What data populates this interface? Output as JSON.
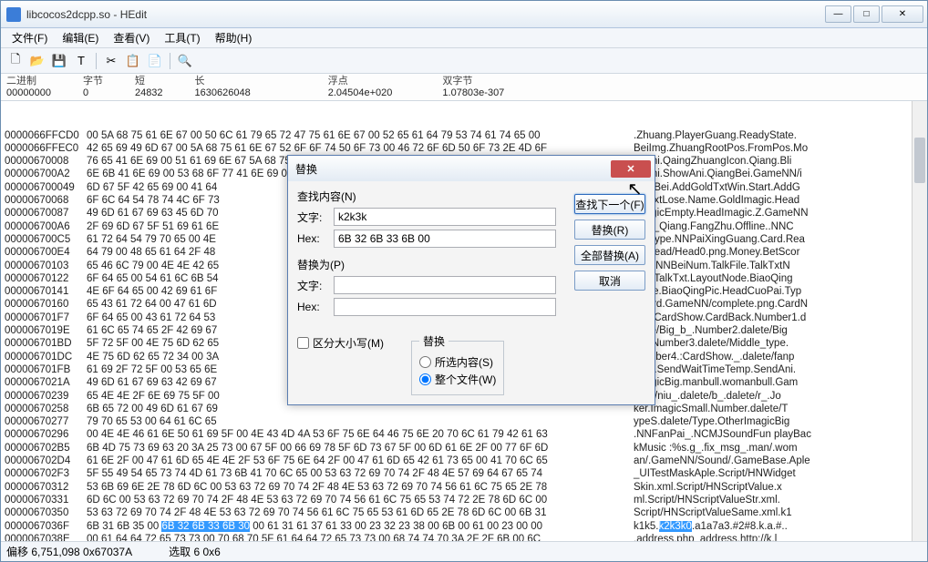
{
  "window": {
    "title": "libcocos2dcpp.so - HEdit"
  },
  "menu": {
    "file": "文件(F)",
    "edit": "编辑(E)",
    "view": "查看(V)",
    "tools": "工具(T)",
    "help": "帮助(H)"
  },
  "info": {
    "binary_lbl": "二进制",
    "binary_val": "00000000",
    "byte_lbl": "字节",
    "byte_val": "0",
    "short_lbl": "短",
    "short_val": "24832",
    "long_lbl": "长",
    "long_val": "1630626048",
    "float_lbl": "浮点",
    "float_val": "2.04504e+020",
    "dword_lbl": "双字节",
    "dword_val": "1.07803e-307"
  },
  "status": {
    "offset": "偏移 6,751,098 0x67037A",
    "selection": "选取 6 0x6"
  },
  "dialog": {
    "title": "替换",
    "find_label": "查找内容(N)",
    "replace_label": "替换为(P)",
    "text_lbl": "文字:",
    "hex_lbl": "Hex:",
    "find_text": "k2k3k",
    "find_hex": "6B 32 6B 33 6B 00",
    "replace_text": "",
    "replace_hex": "",
    "btn_findnext": "查找下一个(F)",
    "btn_replace": "替换(R)",
    "btn_replaceall": "全部替换(A)",
    "btn_cancel": "取消",
    "chk_case": "区分大小写(M)",
    "scope_legend": "替换",
    "scope_sel": "所选内容(S)",
    "scope_all": "整个文件(W)"
  },
  "hex_rows": [
    {
      "a": "0000066FFCD0",
      "h": "00 5A 68 75 61 6E 67 00 50 6C 61 79 65 72 47 75 61 6E 67 00 52 65 61 64 79 53 74 61 74 65 00",
      "t": ".Zhuang.PlayerGuang.ReadyState."
    },
    {
      "a": "0000066FFEC0",
      "h": "42 65 69 49 6D 67 00 5A 68 75 61 6E 67 52 6F 6F 74 50 6F 73 00 46 72 6F 6D 50 6F 73 2E 4D 6F",
      "t": "BeiImg.ZhuangRootPos.FromPos.Mo"
    },
    {
      "a": "00000670008 ",
      "h": "76 65 41 6E 69 00 51 61 69 6E 67 5A 68 75 61 6E 67 49 63 6F 6E 00 51 69 61 6E 67 00 42 6C 69",
      "t": "veAni.QaingZhuangIcon.Qiang.Bli"
    },
    {
      "a": "000006700A2 ",
      "h": "6E 6B 41 6E 69 00 53 68 6F 77 41 6E 69 00 51 69 61 6E 67 42 65 69 00 47 61 6D 65 4E 4E 2F 69",
      "t": "nkAni.ShowAni.QiangBei.GameNN/i"
    },
    {
      "a": "000006700049",
      "h": "6D 67 5F 42 65 69 00 41 64",
      "t": "mg_Bei.AddGoldTxtWin.Start.AddG",
      "short": true
    },
    {
      "a": "00000670068 ",
      "h": "6F 6C 64 54 78 74 4C 6F 73",
      "t": "oldTxtLose.Name.GoldImagic.Head",
      "short": true
    },
    {
      "a": "00000670087 ",
      "h": "49 6D 61 67 69 63 45 6D 70",
      "t": "ImagicEmpty.HeadImagic.Z.GameNN",
      "short": true
    },
    {
      "a": "000006700A6 ",
      "h": "2F 69 6D 67 5F 51 69 61 6E",
      "t": "/img_Qiang.FangZhu.Offline..NNC",
      "short": true
    },
    {
      "a": "000006700C5 ",
      "h": "61 72 64 54 79 70 65 00 4E",
      "t": "ardType.NNPaiXingGuang.Card.Rea",
      "short": true
    },
    {
      "a": "000006700E4 ",
      "h": "64 79 00 48 65 61 64 2F 48",
      "t": "dy.Head/Head0.png.Money.BetScor",
      "short": true
    },
    {
      "a": "00000670103 ",
      "h": "65 46 6C 79 00 4E 4E 42 65",
      "t": "eFly.NNBeiNum.TalkFile.TalkTxtN",
      "short": true
    },
    {
      "a": "00000670122 ",
      "h": "6F 64 65 00 54 61 6C 6B 54",
      "t": "ode.TalkTxt.LayoutNode.BiaoQing",
      "short": true
    },
    {
      "a": "00000670141 ",
      "h": "4E 6F 64 65 00 42 69 61 6F",
      "t": "Node.BiaoQingPic.HeadCuoPai.Typ",
      "short": true
    },
    {
      "a": "00000670160 ",
      "h": "65 43 61 72 64 00 47 61 6D",
      "t": "eCard.GameNN/complete.png.CardN",
      "short": true
    },
    {
      "a": "000006701F7 ",
      "h": "6F 64 65 00 43 61 72 64 53",
      "t": "ode.CardShow.CardBack.Number1.d",
      "short": true
    },
    {
      "a": "0000067019E ",
      "h": "61 6C 65 74 65 2F 42 69 67",
      "t": "alete/Big_b_.Number2.dalete/Big",
      "short": true
    },
    {
      "a": "000006701BD ",
      "h": "5F 72 5F 00 4E 75 6D 62 65",
      "t": "_r_.Number3.dalete/Middle_type.",
      "short": true
    },
    {
      "a": "000006701DC ",
      "h": "4E 75 6D 62 65 72 34 00 3A",
      "t": "Number4.:CardShow._.dalete/fanp",
      "short": true
    },
    {
      "a": "000006701FB ",
      "h": "61 69 2F 72 5F 00 53 65 6E",
      "t": "ai/r_.SendWaitTimeTemp.SendAni.",
      "short": true
    },
    {
      "a": "0000067021A ",
      "h": "49 6D 61 67 69 63 42 69 67",
      "t": "ImagicBig.manbull.womanbull.Gam",
      "short": true
    },
    {
      "a": "00000670239 ",
      "h": "65 4E 4E 2F 6E 69 75 5F 00",
      "t": "eNN/niu_.dalete/b_.dalete/r_.Jo",
      "short": true
    },
    {
      "a": "00000670258 ",
      "h": "6B 65 72 00 49 6D 61 67 69",
      "t": "ker.ImagicSmall.Number.dalete/T",
      "short": true
    },
    {
      "a": "00000670277 ",
      "h": "79 70 65 53 00 64 61 6C 65",
      "t": "ypeS.dalete/Type.OtherImagicBig",
      "short": true
    },
    {
      "a": "00000670296 ",
      "h": "00 4E 4E 46 61 6E 50 61 69 5F 00 4E 43 4D 4A 53 6F 75 6E 64 46 75 6E 20 70 6C 61 79 42 61 63",
      "t": ".NNFanPai_.NCMJSoundFun playBac"
    },
    {
      "a": "000006702B5 ",
      "h": "6B 4D 75 73 69 63 20 3A 25 73 00 67 5F 00 66 69 78 5F 6D 73 67 5F 00 6D 61 6E 2F 00 77 6F 6D",
      "t": "kMusic :%s.g_.fix_msg_.man/.wom"
    },
    {
      "a": "000006702D4 ",
      "h": "61 6E 2F 00 47 61 6D 65 4E 4E 2F 53 6F 75 6E 64 2F 00 47 61 6D 65 42 61 73 65 00 41 70 6C 65",
      "t": "an/.GameNN/Sound/.GameBase.Aple"
    },
    {
      "a": "000006702F3 ",
      "h": "5F 55 49 54 65 73 74 4D 61 73 6B 41 70 6C 65 00 53 63 72 69 70 74 2F 48 4E 57 69 64 67 65 74",
      "t": "_UITestMaskAple.Script/HNWidget"
    },
    {
      "a": "00000670312 ",
      "h": "53 6B 69 6E 2E 78 6D 6C 00 53 63 72 69 70 74 2F 48 4E 53 63 72 69 70 74 56 61 6C 75 65 2E 78",
      "t": "Skin.xml.Script/HNScriptValue.x"
    },
    {
      "a": "00000670331 ",
      "h": "6D 6C 00 53 63 72 69 70 74 2F 48 4E 53 63 72 69 70 74 56 61 6C 75 65 53 74 72 2E 78 6D 6C 00",
      "t": "ml.Script/HNScriptValueStr.xml."
    },
    {
      "a": "00000670350 ",
      "h": "53 63 72 69 70 74 2F 48 4E 53 63 72 69 70 74 56 61 6C 75 65 53 61 6D 65 2E 78 6D 6C 00 6B 31",
      "t": "Script/HNScriptValueSame.xml.k1"
    },
    {
      "a": "0000067036F ",
      "h": "6B 31 6B 35 00 ",
      "h2": "6B 32 6B 33 6B 30",
      "h3": " 00 61 31 61 37 61 33 00 23 32 23 38 00 6B 00 61 00 23 00 00",
      "t": "k1k5.",
      "t2": "k2k3k0",
      "t3": ".a1a7a3.#2#8.k.a.#.."
    },
    {
      "a": "0000067038E ",
      "h": "00 61 64 64 72 65 73 73 00 70 68 70 5F 61 64 64 72 65 73 73 00 68 74 74 70 3A 2F 2F 6B 00 6C",
      "t": ".address.php_address.http://k.l"
    }
  ]
}
